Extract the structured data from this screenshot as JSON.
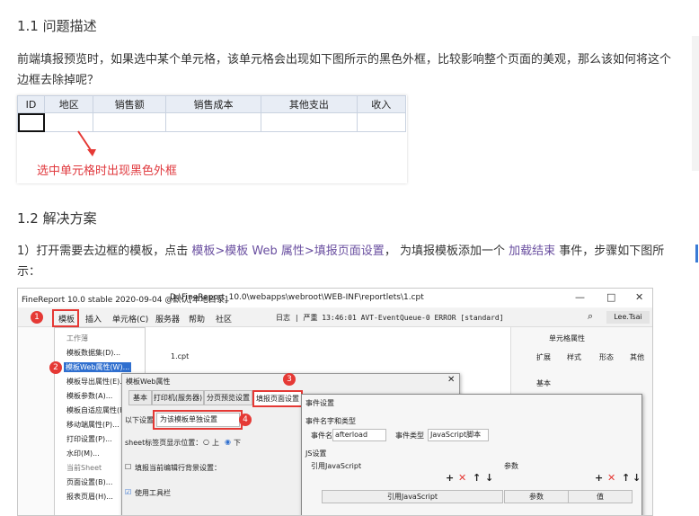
{
  "section1": {
    "heading": "1.1 问题描述",
    "para": "前端填报预览时，如果选中某个单元格，该单元格会出现如下图所示的黑色外框，比较影响整个页面的美观，那么该如何将这个边框去除掉呢？"
  },
  "figure1": {
    "headers": [
      "ID",
      "地区",
      "销售额",
      "销售成本",
      "其他支出",
      "收入"
    ],
    "note": "选中单元格时出现黑色外框"
  },
  "section2": {
    "heading": "1.2 解决方案",
    "step_prefix": "1）打开需要去边框的模板，点击 ",
    "link1": "模板>模板 Web 属性>填报页面设置",
    "step_mid": "， 为填报模板添加一个 ",
    "link2": "加载结束",
    "step_suffix": " 事件，步骤如下图所示："
  },
  "figure2": {
    "title": "FineReport 10.0 stable 2020-09-04 @默认[本地目录]",
    "path": "D:\\FineReport_10.0\\webapps\\webroot\\WEB-INF\\reportlets\\1.cpt",
    "window_controls": [
      "—",
      "□",
      "✕"
    ],
    "menus": [
      "模板",
      "插入",
      "单元格(C)",
      "服务器",
      "帮助",
      "社区"
    ],
    "log": "日志 | 严重 13:46:01 AVT-EventQueue-0 ERROR [standard]",
    "user": "Lee.Tsai",
    "menu_items": [
      "工作薄",
      "模板数据集(D)...",
      "模板Web属性(W)...",
      "模板导出属性(E)...",
      "模板参数(A)...",
      "模板自适应属性(F)...",
      "移动端属性(P)...",
      "打印设置(P)...",
      "水印(M)...",
      "当前Sheet",
      "页面设置(B)...",
      "报表页眉(H)..."
    ],
    "tab_file": "1.cpt",
    "dlg1_title": "模板Web属性",
    "dlg1_tabs": [
      "基本",
      "打印机(服务器)",
      "分页预览设置",
      "填报页面设置"
    ],
    "dlg1_setting_label": "以下设置",
    "dlg1_select": "为该模板单独设置",
    "dlg1_sheet_label": "sheet标签页显示位置：",
    "dlg1_radio_up": "上",
    "dlg1_radio_down": "下",
    "dlg1_bg_label": "填报当前编辑行背景设置：",
    "dlg1_toolbar": "使用工具栏",
    "dlg2_title": "事件设置",
    "dlg2_group": "事件名字和类型",
    "dlg2_name_label": "事件名",
    "dlg2_name_value": "afterload",
    "dlg2_type_label": "事件类型",
    "dlg2_type_value": "JavaScript脚本",
    "dlg2_js_group": "JS设置",
    "dlg2_ref_label": "引用JavaScript",
    "dlg2_param_label": "参数",
    "dlg2_ref_header": "引用JavaScript",
    "dlg2_param_header": "参数",
    "dlg2_value_header": "值",
    "rpanel_title": "单元格属性",
    "rpanel_tabs": [
      "扩展",
      "样式",
      "形态",
      "其他"
    ],
    "rpanel_basic": "基本",
    "badges": [
      "1",
      "2",
      "3",
      "4"
    ],
    "colors": {
      "accent_red": "#e53935",
      "link": "#6a4fa0",
      "selected_blue": "#2f6fcf"
    }
  }
}
